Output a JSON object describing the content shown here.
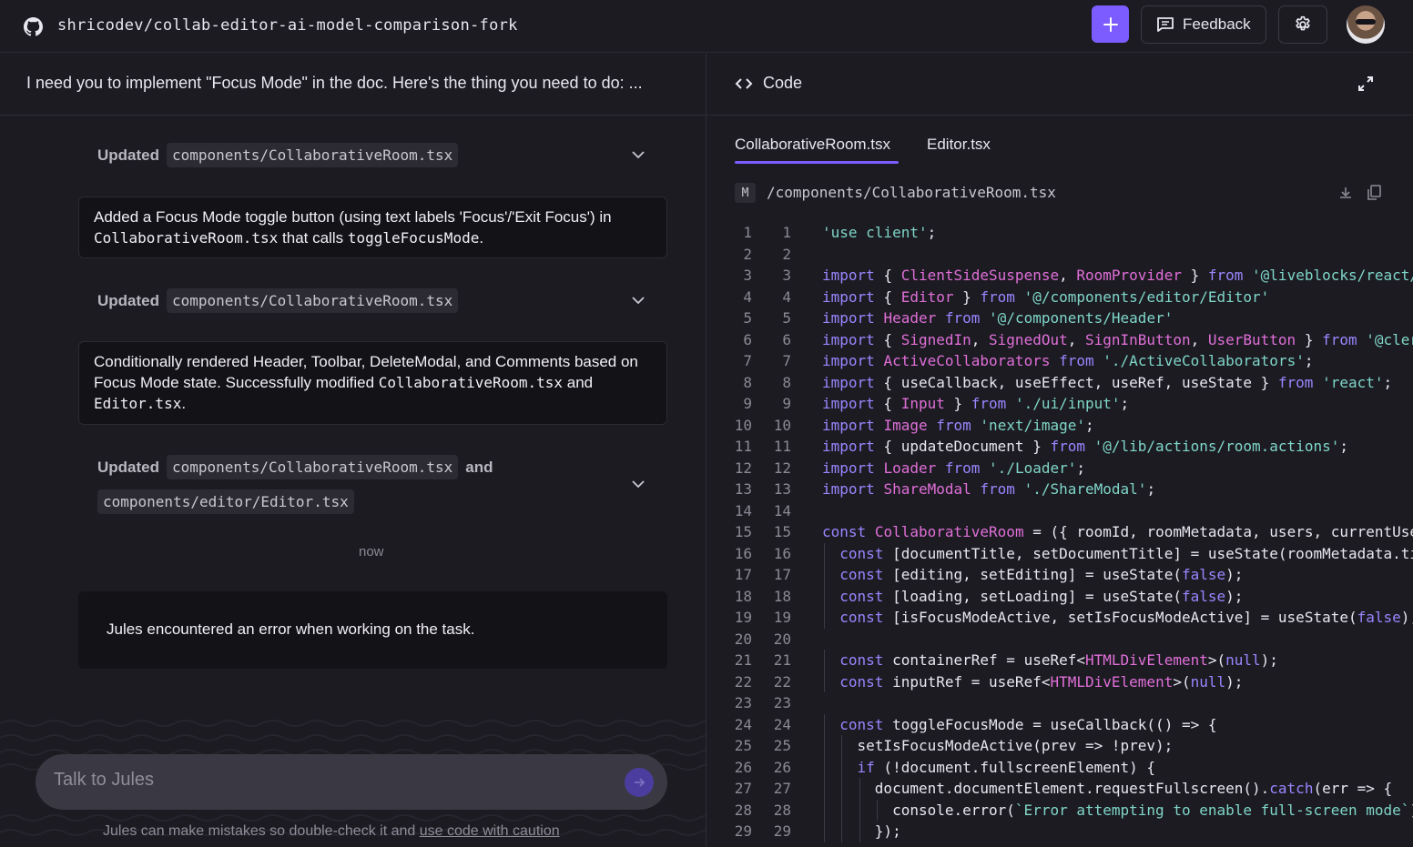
{
  "topbar": {
    "repo": "shricodev/collab-editor-ai-model-comparison-fork",
    "feedback_label": "Feedback"
  },
  "task": {
    "title": "I need you to implement \"Focus Mode\" in the doc. Here's the thing you need to do: ..."
  },
  "activity": [
    {
      "label": "Updated",
      "files": [
        "components/CollaborativeRoom.tsx"
      ]
    },
    {
      "label": "Updated",
      "files": [
        "components/CollaborativeRoom.tsx"
      ]
    },
    {
      "label": "Updated",
      "files": [
        "components/CollaborativeRoom.tsx",
        "components/editor/Editor.tsx"
      ],
      "joiner": "and"
    }
  ],
  "messages": {
    "m1": {
      "t1": "Added a Focus Mode toggle button (using text labels 'Focus'/'Exit Focus') in ",
      "c1": "CollaborativeRoom.tsx",
      "t2": " that calls ",
      "c2": "toggleFocusMode",
      "t3": "."
    },
    "m2": {
      "t1": "Conditionally rendered Header, Toolbar, DeleteModal, and Comments based on Focus Mode state. Successfully modified ",
      "c1": "CollaborativeRoom.tsx",
      "t2": " and ",
      "c2": "Editor.tsx",
      "t3": "."
    }
  },
  "timestamp": "now",
  "error_message": "Jules encountered an error when working on the task.",
  "composer": {
    "placeholder": "Talk to Jules",
    "disclaimer": "Jules can make mistakes so double-check it and ",
    "disclaimer_link": "use code with caution"
  },
  "code_panel": {
    "title": "Code",
    "tabs": [
      "CollaborativeRoom.tsx",
      "Editor.tsx"
    ],
    "active_tab": 0,
    "file_status": "M",
    "file_path": "/components/CollaborativeRoom.tsx",
    "lines": [
      [
        [
          "s",
          "'use client'"
        ],
        [
          "n",
          ";"
        ]
      ],
      [],
      [
        [
          "k",
          "import"
        ],
        [
          "n",
          " { "
        ],
        [
          "f",
          "ClientSideSuspense"
        ],
        [
          "n",
          ", "
        ],
        [
          "f",
          "RoomProvider"
        ],
        [
          "n",
          " } "
        ],
        [
          "k",
          "from"
        ],
        [
          "n",
          " "
        ],
        [
          "s",
          "'@liveblocks/react/suspense'"
        ],
        [
          "n",
          ";"
        ]
      ],
      [
        [
          "k",
          "import"
        ],
        [
          "n",
          " { "
        ],
        [
          "f",
          "Editor"
        ],
        [
          "n",
          " } "
        ],
        [
          "k",
          "from"
        ],
        [
          "n",
          " "
        ],
        [
          "s",
          "'@/components/editor/Editor'"
        ]
      ],
      [
        [
          "k",
          "import"
        ],
        [
          "n",
          " "
        ],
        [
          "f",
          "Header"
        ],
        [
          "n",
          " "
        ],
        [
          "k",
          "from"
        ],
        [
          "n",
          " "
        ],
        [
          "s",
          "'@/components/Header'"
        ]
      ],
      [
        [
          "k",
          "import"
        ],
        [
          "n",
          " { "
        ],
        [
          "f",
          "SignedIn"
        ],
        [
          "n",
          ", "
        ],
        [
          "f",
          "SignedOut"
        ],
        [
          "n",
          ", "
        ],
        [
          "f",
          "SignInButton"
        ],
        [
          "n",
          ", "
        ],
        [
          "f",
          "UserButton"
        ],
        [
          "n",
          " } "
        ],
        [
          "k",
          "from"
        ],
        [
          "n",
          " "
        ],
        [
          "s",
          "'@clerk/nextjs'"
        ]
      ],
      [
        [
          "k",
          "import"
        ],
        [
          "n",
          " "
        ],
        [
          "f",
          "ActiveCollaborators"
        ],
        [
          "n",
          " "
        ],
        [
          "k",
          "from"
        ],
        [
          "n",
          " "
        ],
        [
          "s",
          "'./ActiveCollaborators'"
        ],
        [
          "n",
          ";"
        ]
      ],
      [
        [
          "k",
          "import"
        ],
        [
          "n",
          " { useCallback, useEffect, useRef, useState } "
        ],
        [
          "k",
          "from"
        ],
        [
          "n",
          " "
        ],
        [
          "s",
          "'react'"
        ],
        [
          "n",
          ";"
        ]
      ],
      [
        [
          "k",
          "import"
        ],
        [
          "n",
          " { "
        ],
        [
          "f",
          "Input"
        ],
        [
          "n",
          " } "
        ],
        [
          "k",
          "from"
        ],
        [
          "n",
          " "
        ],
        [
          "s",
          "'./ui/input'"
        ],
        [
          "n",
          ";"
        ]
      ],
      [
        [
          "k",
          "import"
        ],
        [
          "n",
          " "
        ],
        [
          "f",
          "Image"
        ],
        [
          "n",
          " "
        ],
        [
          "k",
          "from"
        ],
        [
          "n",
          " "
        ],
        [
          "s",
          "'next/image'"
        ],
        [
          "n",
          ";"
        ]
      ],
      [
        [
          "k",
          "import"
        ],
        [
          "n",
          " { updateDocument } "
        ],
        [
          "k",
          "from"
        ],
        [
          "n",
          " "
        ],
        [
          "s",
          "'@/lib/actions/room.actions'"
        ],
        [
          "n",
          ";"
        ]
      ],
      [
        [
          "k",
          "import"
        ],
        [
          "n",
          " "
        ],
        [
          "f",
          "Loader"
        ],
        [
          "n",
          " "
        ],
        [
          "k",
          "from"
        ],
        [
          "n",
          " "
        ],
        [
          "s",
          "'./Loader'"
        ],
        [
          "n",
          ";"
        ]
      ],
      [
        [
          "k",
          "import"
        ],
        [
          "n",
          " "
        ],
        [
          "f",
          "ShareModal"
        ],
        [
          "n",
          " "
        ],
        [
          "k",
          "from"
        ],
        [
          "n",
          " "
        ],
        [
          "s",
          "'./ShareModal'"
        ],
        [
          "n",
          ";"
        ]
      ],
      [],
      [
        [
          "k",
          "const"
        ],
        [
          "n",
          " "
        ],
        [
          "f",
          "CollaborativeRoom"
        ],
        [
          "n",
          " = ({ roomId, roomMetadata, users, currentUserType }) => {"
        ]
      ],
      [
        [
          "n",
          "  "
        ],
        [
          "k",
          "const"
        ],
        [
          "n",
          " [documentTitle, setDocumentTitle] = useState(roomMetadata.title);"
        ]
      ],
      [
        [
          "n",
          "  "
        ],
        [
          "k",
          "const"
        ],
        [
          "n",
          " [editing, setEditing] = useState("
        ],
        [
          "k",
          "false"
        ],
        [
          "n",
          ");"
        ]
      ],
      [
        [
          "n",
          "  "
        ],
        [
          "k",
          "const"
        ],
        [
          "n",
          " [loading, setLoading] = useState("
        ],
        [
          "k",
          "false"
        ],
        [
          "n",
          ");"
        ]
      ],
      [
        [
          "n",
          "  "
        ],
        [
          "k",
          "const"
        ],
        [
          "n",
          " [isFocusModeActive, setIsFocusModeActive] = useState("
        ],
        [
          "k",
          "false"
        ],
        [
          "n",
          ");"
        ]
      ],
      [],
      [
        [
          "n",
          "  "
        ],
        [
          "k",
          "const"
        ],
        [
          "n",
          " containerRef = useRef<"
        ],
        [
          "f",
          "HTMLDivElement"
        ],
        [
          "n",
          ">("
        ],
        [
          "k",
          "null"
        ],
        [
          "n",
          ");"
        ]
      ],
      [
        [
          "n",
          "  "
        ],
        [
          "k",
          "const"
        ],
        [
          "n",
          " inputRef = useRef<"
        ],
        [
          "f",
          "HTMLDivElement"
        ],
        [
          "n",
          ">("
        ],
        [
          "k",
          "null"
        ],
        [
          "n",
          ");"
        ]
      ],
      [],
      [
        [
          "n",
          "  "
        ],
        [
          "k",
          "const"
        ],
        [
          "n",
          " toggleFocusMode = useCallback(() => {"
        ]
      ],
      [
        [
          "n",
          "    setIsFocusModeActive(prev => !prev);"
        ]
      ],
      [
        [
          "n",
          "    "
        ],
        [
          "k",
          "if"
        ],
        [
          "n",
          " (!document.fullscreenElement) {"
        ]
      ],
      [
        [
          "n",
          "      document.documentElement.requestFullscreen()."
        ],
        [
          "k",
          "catch"
        ],
        [
          "n",
          "(err => {"
        ]
      ],
      [
        [
          "n",
          "        console.error("
        ],
        [
          "s",
          "`Error attempting to enable full-screen mode`"
        ],
        [
          "n",
          ");"
        ]
      ],
      [
        [
          "n",
          "      });"
        ]
      ]
    ],
    "guides": [
      [],
      [],
      [],
      [],
      [],
      [],
      [],
      [],
      [],
      [],
      [],
      [],
      [],
      [],
      [],
      [
        1
      ],
      [
        1
      ],
      [
        1
      ],
      [
        1
      ],
      [],
      [
        1
      ],
      [
        1
      ],
      [],
      [
        1
      ],
      [
        1,
        2
      ],
      [
        1,
        2
      ],
      [
        1,
        2,
        3
      ],
      [
        1,
        2,
        3,
        4
      ],
      [
        1,
        2,
        3
      ]
    ]
  }
}
